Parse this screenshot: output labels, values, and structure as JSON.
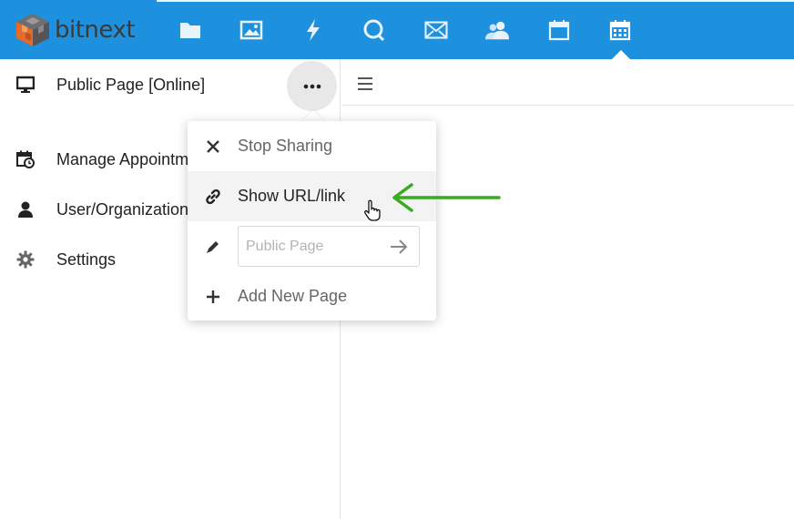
{
  "header": {
    "logo_text": "bitnext",
    "brand_color": "#1e91de",
    "nav_icons": [
      "folder-icon",
      "image-icon",
      "lightning-icon",
      "chat-icon",
      "mail-icon",
      "users-icon",
      "calendar-icon",
      "calendar-grid-icon"
    ],
    "active_nav": "calendar-grid-icon"
  },
  "sidebar": {
    "page_item": {
      "icon": "monitor-icon",
      "label": "Public Page [Online]"
    },
    "items": [
      {
        "icon": "calendar-clock-icon",
        "label": "Manage Appointm"
      },
      {
        "icon": "user-icon",
        "label": "User/Organization"
      },
      {
        "icon": "gear-icon",
        "label": "Settings"
      }
    ]
  },
  "content": {
    "menu_icon": "hamburger-icon"
  },
  "menu": {
    "stop_sharing": "Stop Sharing",
    "show_url": "Show URL/link",
    "rename_placeholder": "Public Page",
    "add_new_page": "Add New Page",
    "hover_item": "show_url"
  },
  "annotation": {
    "arrow_color": "#3aaa1f"
  }
}
